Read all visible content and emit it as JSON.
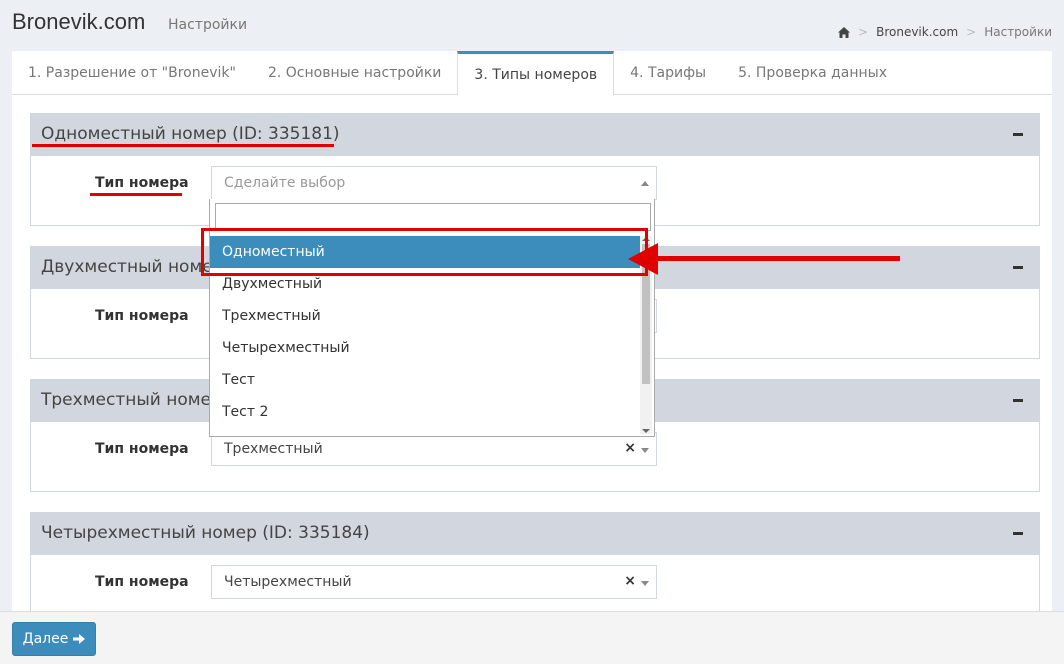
{
  "header": {
    "title": "Bronevik.com",
    "subtitle": "Настройки",
    "breadcrumb": {
      "home_icon": "home-icon",
      "site": "Bronevik.com",
      "current": "Настройки"
    }
  },
  "tabs": [
    {
      "label": "1. Разрешение от \"Bronevik\"",
      "active": false
    },
    {
      "label": "2. Основные настройки",
      "active": false
    },
    {
      "label": "3. Типы номеров",
      "active": true
    },
    {
      "label": "4. Тарифы",
      "active": false
    },
    {
      "label": "5. Проверка данных",
      "active": false
    }
  ],
  "rooms": [
    {
      "title": "Одноместный номер (ID: 335181)",
      "field_label": "Тип номера",
      "value": "",
      "placeholder": "Сделайте выбор",
      "open": true
    },
    {
      "title": "Двухместный номер",
      "field_label": "Тип номера",
      "value": "",
      "placeholder": ""
    },
    {
      "title": "Трехместный номер",
      "field_label": "Тип номера",
      "value": "Трехместный",
      "clear": "×"
    },
    {
      "title": "Четырехместный номер (ID: 335184)",
      "field_label": "Тип номера",
      "value": "Четырехместный",
      "clear": "×"
    }
  ],
  "dropdown": {
    "search_value": "",
    "options": [
      "Одноместный",
      "Двухместный",
      "Трехместный",
      "Четырехместный",
      "Тест",
      "Тест 2"
    ],
    "highlighted_index": 0
  },
  "footer": {
    "next_label": "Далее",
    "next_icon": "arrow-right-icon"
  },
  "colors": {
    "accent": "#3c8dbc",
    "annotation": "#e00000",
    "box_header": "#d2d6de",
    "background": "#ecf0f5"
  }
}
